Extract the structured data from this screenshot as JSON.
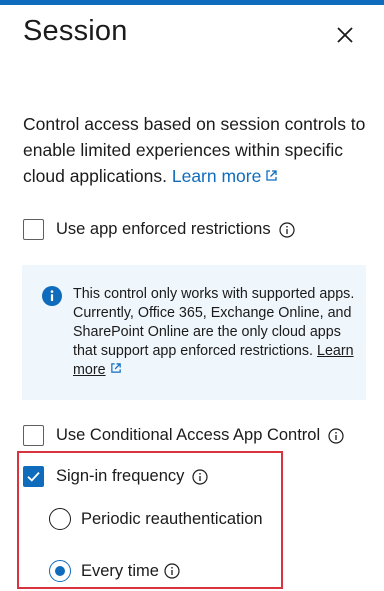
{
  "panel": {
    "title": "Session",
    "accent_color": "#0f6cbd",
    "icons": {
      "close": "close-icon",
      "info": "info-icon",
      "external_link": "external-link-icon"
    }
  },
  "description": {
    "text": "Control access based on session controls to enable limited experiences within specific cloud applications.",
    "learn_more": "Learn more"
  },
  "options": {
    "app_enforced": {
      "label": "Use app enforced restrictions",
      "checked": false
    },
    "conditional_access": {
      "label": "Use Conditional Access App Control",
      "checked": false
    },
    "sign_in_frequency": {
      "label": "Sign-in frequency",
      "checked": true
    }
  },
  "infobox": {
    "text": "This control only works with supported apps. Currently, Office 365, Exchange Online, and SharePoint Online are the only cloud apps that support app enforced restrictions.",
    "learn_more": "Learn more"
  },
  "frequency_options": [
    {
      "label": "Periodic reauthentication",
      "selected": false
    },
    {
      "label": "Every time",
      "selected": true
    }
  ]
}
